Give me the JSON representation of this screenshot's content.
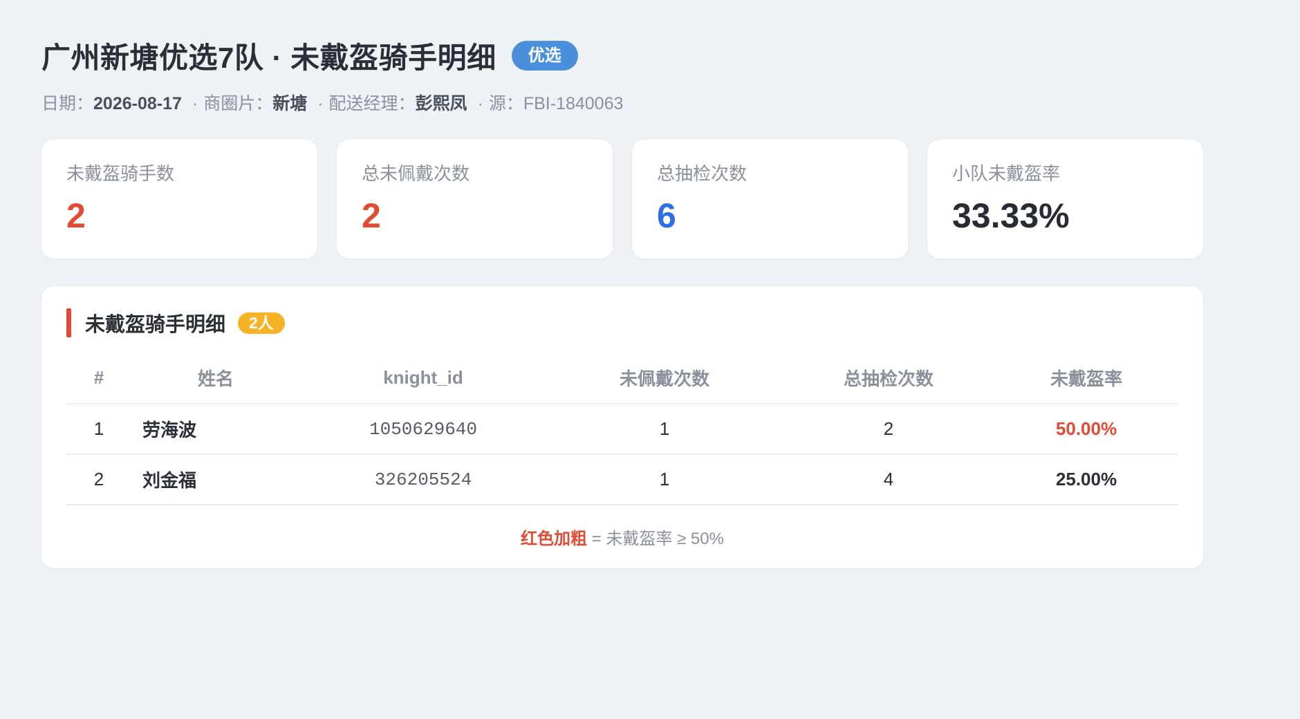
{
  "header": {
    "title": "广州新塘优选7队 · 未戴盔骑手明细",
    "tag": "优选",
    "date_label": "日期：",
    "date": "2026-08-17",
    "area_label": "商圈片：",
    "area": "新塘",
    "manager_label": "配送经理：",
    "manager": "彭熙凤",
    "source_label": "源：",
    "source": "FBI-1840063",
    "separator": "·"
  },
  "stats": [
    {
      "label": "未戴盔骑手数",
      "value": "2"
    },
    {
      "label": "总未佩戴次数",
      "value": "2"
    },
    {
      "label": "总抽检次数",
      "value": "6"
    },
    {
      "label": "小队未戴盔率",
      "value": "33.33%"
    }
  ],
  "panel": {
    "title": "未戴盔骑手明细",
    "count_badge": "2人",
    "columns": [
      "#",
      "姓名",
      "knight_id",
      "未佩戴次数",
      "总抽检次数",
      "未戴盔率"
    ],
    "rows": [
      {
        "idx": "1",
        "name": "劳海波",
        "knight_id": "1050629640",
        "missed": "1",
        "checked": "2",
        "rate": "50.00%"
      },
      {
        "idx": "2",
        "name": "刘金福",
        "knight_id": "326205524",
        "missed": "1",
        "checked": "4",
        "rate": "25.00%"
      }
    ],
    "legend_key": "红色加粗",
    "legend_text": " = 未戴盔率 ≥ 50%"
  },
  "colors": {
    "accent_red": "#e24b33",
    "accent_blue": "#2e6fe6",
    "tag_blue": "#4a8fdc",
    "badge_orange": "#f7b325",
    "background": "#eef1f6"
  }
}
